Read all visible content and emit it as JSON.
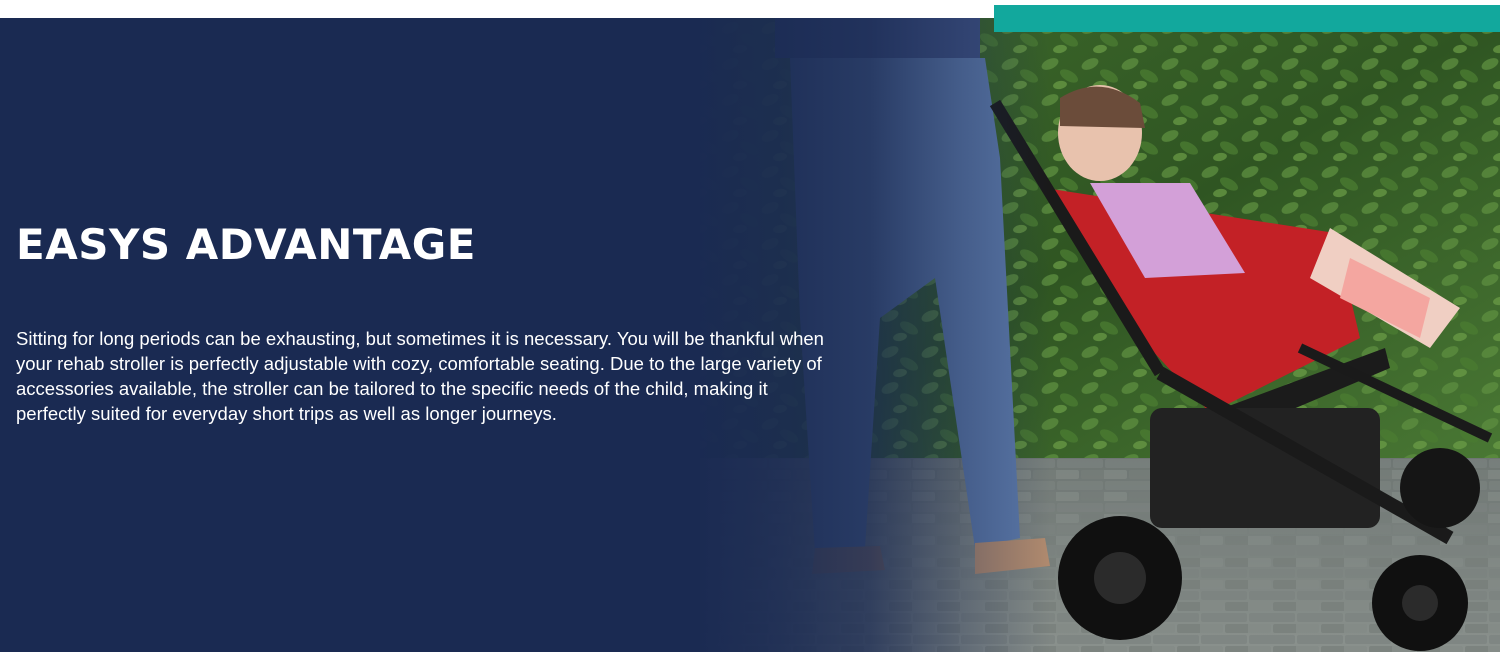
{
  "hero": {
    "title": "EASYS ADVANTAGE",
    "description": "Sitting for long periods can be exhausting, but sometimes it is necessary. You will be thankful when your rehab stroller is perfectly adjustable with cozy, comfortable seating. Due to the large variety of accessories available, the stroller can be tailored to the specific needs of the child, making it perfectly suited for everyday short trips as well as longer journeys.",
    "overlay_color": "#1a2a52"
  },
  "accent": {
    "teal": "#12a89d"
  }
}
